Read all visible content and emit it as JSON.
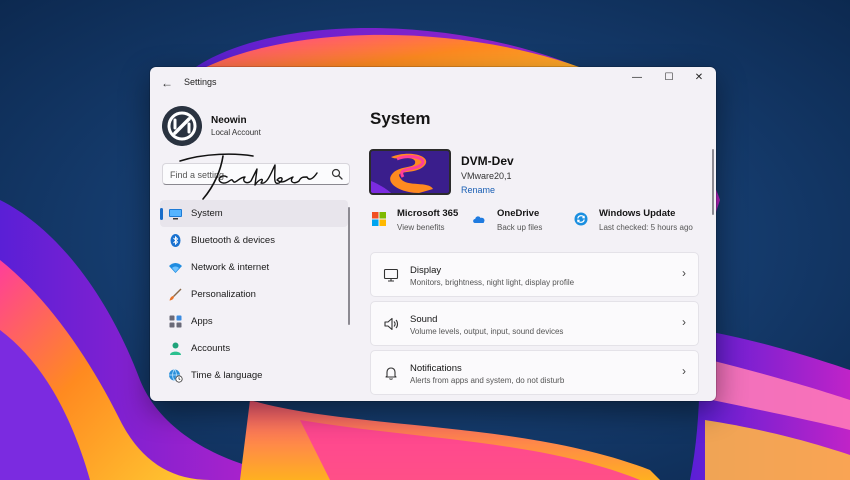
{
  "window": {
    "app_title": "Settings",
    "controls": {
      "minimize": "—",
      "maximize": "☐",
      "close": "✕"
    }
  },
  "profile": {
    "name": "Neowin",
    "account_type": "Local Account"
  },
  "search": {
    "placeholder": "Find a setting"
  },
  "overlay_text": "Taskbar",
  "sidebar": {
    "items": [
      {
        "label": "System",
        "icon": "system-icon",
        "selected": true
      },
      {
        "label": "Bluetooth & devices",
        "icon": "bluetooth-icon"
      },
      {
        "label": "Network & internet",
        "icon": "wifi-icon"
      },
      {
        "label": "Personalization",
        "icon": "brush-icon"
      },
      {
        "label": "Apps",
        "icon": "apps-icon"
      },
      {
        "label": "Accounts",
        "icon": "person-icon"
      },
      {
        "label": "Time & language",
        "icon": "globe-clock-icon"
      }
    ]
  },
  "main": {
    "title": "System",
    "device": {
      "name": "DVM-Dev",
      "model": "VMware20,1",
      "rename": "Rename"
    },
    "quick": [
      {
        "title": "Microsoft 365",
        "subtitle": "View benefits",
        "icon": "microsoft-icon"
      },
      {
        "title": "OneDrive",
        "subtitle": "Back up files",
        "icon": "onedrive-icon"
      },
      {
        "title": "Windows Update",
        "subtitle": "Last checked: 5 hours ago",
        "icon": "windows-update-icon"
      }
    ],
    "cards": [
      {
        "title": "Display",
        "subtitle": "Monitors, brightness, night light, display profile",
        "icon": "display-icon"
      },
      {
        "title": "Sound",
        "subtitle": "Volume levels, output, input, sound devices",
        "icon": "speaker-icon"
      },
      {
        "title": "Notifications",
        "subtitle": "Alerts from apps and system, do not disturb",
        "icon": "bell-icon"
      }
    ]
  },
  "colors": {
    "accent": "#1a6cc8",
    "window_bg": "#f3f1f6",
    "desktop_bg": "#0c2a52"
  }
}
